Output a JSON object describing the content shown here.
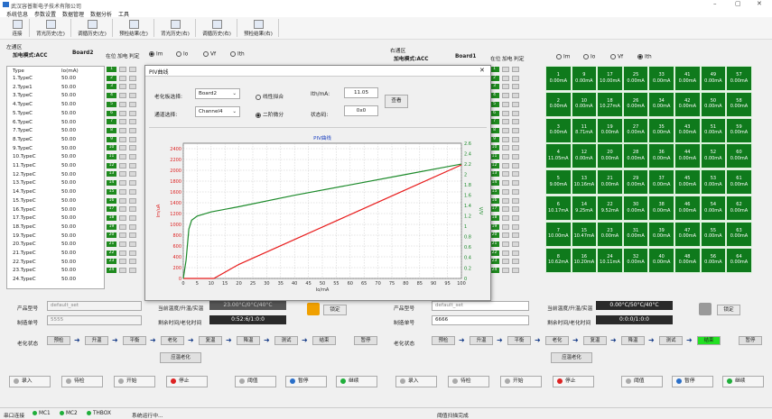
{
  "window": {
    "title": "武汉容普斯电子技术有限公司",
    "min": "–",
    "max": "▢",
    "close": "✕"
  },
  "menu": [
    "系统信息",
    "参数设置",
    "数据管理",
    "数据分析",
    "工具"
  ],
  "toolbar": [
    "连接",
    "背光历史(左)",
    "调循历史(左)",
    "预检结果(左)",
    "背光历史(右)",
    "调循历史(右)",
    "预检结果(右)"
  ],
  "left": {
    "area": "左通区",
    "mode_label": "加电模式:ACC",
    "board": "Board2",
    "cols": [
      "在位",
      "加电",
      "判定"
    ],
    "table_head": [
      "Type",
      "Io(mA)"
    ],
    "rows": [
      [
        "1.TypeC",
        "50.00"
      ],
      [
        "2.Type1",
        "50.00"
      ],
      [
        "3.TypeC",
        "50.00"
      ],
      [
        "4.TypeC",
        "50.00"
      ],
      [
        "5.TypeC",
        "50.00"
      ],
      [
        "6.TypeC",
        "50.00"
      ],
      [
        "7.TypeC",
        "50.00"
      ],
      [
        "8.TypeC",
        "50.00"
      ],
      [
        "9.TypeC",
        "50.00"
      ],
      [
        "10.TypeC",
        "50.00"
      ],
      [
        "11.TypeC",
        "50.00"
      ],
      [
        "12.TypeC",
        "50.00"
      ],
      [
        "13.TypeC",
        "50.00"
      ],
      [
        "14.TypeC",
        "50.00"
      ],
      [
        "15.TypeC",
        "50.00"
      ],
      [
        "16.TypeC",
        "50.00"
      ],
      [
        "17.TypeC",
        "50.00"
      ],
      [
        "18.TypeC",
        "50.00"
      ],
      [
        "19.TypeC",
        "50.00"
      ],
      [
        "20.TypeC",
        "50.00"
      ],
      [
        "21.TypeC",
        "50.00"
      ],
      [
        "22.TypeC",
        "50.00"
      ],
      [
        "23.TypeC",
        "50.00"
      ],
      [
        "24.TypeC",
        "50.00"
      ]
    ],
    "radios": [
      "Im",
      "Io",
      "Vf",
      "Ith"
    ],
    "product_label": "产品型号",
    "product_value": "default_set",
    "order_label": "制造单号",
    "order_value": "5555",
    "temp_label": "当前温度/升温/实温",
    "temp_value": "23.00°C/0°C/40°C",
    "time_label": "剩余时间/老化时间",
    "time_value": "0:52:6/1:0:0",
    "lock_label": "锁定",
    "state_label": "老化状态",
    "steps": [
      "预检",
      "升温",
      "平衡",
      "老化",
      "复温",
      "降温",
      "测试",
      "结束",
      "暂停"
    ],
    "back_label": "应温老化",
    "buttons": [
      "录入",
      "待检",
      "开始",
      "停止",
      "阈值",
      "暂停",
      "继续"
    ]
  },
  "right": {
    "area": "右通区",
    "mode_label": "加电模式:ACC",
    "board": "Board1",
    "cols": [
      "在位",
      "加电",
      "判定"
    ],
    "radios": [
      "Im",
      "Io",
      "Vf",
      "Ith"
    ],
    "cells": [
      [
        "1",
        "0.00mA"
      ],
      [
        "9",
        "0.00mA"
      ],
      [
        "17",
        "10.00mA"
      ],
      [
        "25",
        "0.00mA"
      ],
      [
        "33",
        "0.00mA"
      ],
      [
        "41",
        "0.00mA"
      ],
      [
        "49",
        "0.00mA"
      ],
      [
        "57",
        "0.00mA"
      ],
      [
        "2",
        "0.00mA"
      ],
      [
        "10",
        "0.00mA"
      ],
      [
        "18",
        "10.27mA"
      ],
      [
        "26",
        "0.00mA"
      ],
      [
        "34",
        "0.00mA"
      ],
      [
        "42",
        "0.00mA"
      ],
      [
        "50",
        "0.00mA"
      ],
      [
        "58",
        "0.00mA"
      ],
      [
        "3",
        "0.00mA"
      ],
      [
        "11",
        "8.71mA"
      ],
      [
        "19",
        "0.00mA"
      ],
      [
        "27",
        "0.00mA"
      ],
      [
        "35",
        "0.00mA"
      ],
      [
        "43",
        "0.00mA"
      ],
      [
        "51",
        "0.00mA"
      ],
      [
        "59",
        "0.00mA"
      ],
      [
        "4",
        "11.05mA"
      ],
      [
        "12",
        "0.00mA"
      ],
      [
        "20",
        "0.00mA"
      ],
      [
        "28",
        "0.00mA"
      ],
      [
        "36",
        "0.00mA"
      ],
      [
        "44",
        "0.00mA"
      ],
      [
        "52",
        "0.00mA"
      ],
      [
        "60",
        "0.00mA"
      ],
      [
        "5",
        "9.00mA"
      ],
      [
        "13",
        "10.16mA"
      ],
      [
        "21",
        "0.00mA"
      ],
      [
        "29",
        "0.00mA"
      ],
      [
        "37",
        "0.00mA"
      ],
      [
        "45",
        "0.00mA"
      ],
      [
        "53",
        "0.00mA"
      ],
      [
        "61",
        "0.00mA"
      ],
      [
        "6",
        "10.17mA"
      ],
      [
        "14",
        "9.25mA"
      ],
      [
        "22",
        "9.52mA"
      ],
      [
        "30",
        "0.00mA"
      ],
      [
        "38",
        "0.00mA"
      ],
      [
        "46",
        "0.00mA"
      ],
      [
        "54",
        "0.00mA"
      ],
      [
        "62",
        "0.00mA"
      ],
      [
        "7",
        "10.00mA"
      ],
      [
        "15",
        "10.47mA"
      ],
      [
        "23",
        "0.00mA"
      ],
      [
        "31",
        "0.00mA"
      ],
      [
        "39",
        "0.00mA"
      ],
      [
        "47",
        "0.00mA"
      ],
      [
        "55",
        "0.00mA"
      ],
      [
        "63",
        "0.00mA"
      ],
      [
        "8",
        "10.62mA"
      ],
      [
        "16",
        "10.20mA"
      ],
      [
        "24",
        "10.11mA"
      ],
      [
        "32",
        "0.00mA"
      ],
      [
        "40",
        "0.00mA"
      ],
      [
        "48",
        "0.00mA"
      ],
      [
        "56",
        "0.00mA"
      ],
      [
        "64",
        "0.00mA"
      ]
    ],
    "product_label": "产品型号",
    "product_value": "default_set",
    "order_label": "制造单号",
    "order_value": "6666",
    "temp_label": "当前温度/升温/实温",
    "temp_value": "0.00°C/50°C/40°C",
    "time_label": "剩余时间/老化时间",
    "time_value": "0:0:0/1:0:0",
    "lock_label": "锁定",
    "state_label": "老化状态",
    "steps": [
      "预检",
      "升温",
      "平衡",
      "老化",
      "复温",
      "降温",
      "测试",
      "结束",
      "暂停"
    ],
    "back_label": "应温老化",
    "buttons": [
      "录入",
      "待检",
      "开始",
      "停止",
      "阈值",
      "暂停",
      "继续"
    ]
  },
  "modal": {
    "title": "PIV曲线",
    "close": "✕",
    "board_label": "老化板选择:",
    "board_value": "Board2",
    "channel_label": "通道选择:",
    "channel_value": "Channel4",
    "radio1": "线性拟合",
    "radio2": "二阶微分",
    "ith_label": "Ith/mA:",
    "ith_value": "11.05",
    "state_label": "状态码:",
    "state_value": "0x0",
    "query": "查看"
  },
  "chart_data": {
    "type": "line",
    "title": "PIV曲线",
    "xlabel": "Io/mA",
    "ylabel": "Im/uA",
    "y2label": "V/V",
    "xlim": [
      0,
      100
    ],
    "ylim": [
      0,
      2500
    ],
    "y2lim": [
      0,
      2.6
    ],
    "xticks": [
      0,
      5,
      10,
      15,
      20,
      25,
      30,
      35,
      40,
      45,
      50,
      55,
      60,
      65,
      70,
      75,
      80,
      85,
      90,
      95,
      100
    ],
    "yticks": [
      0,
      200,
      400,
      600,
      800,
      1000,
      1200,
      1400,
      1600,
      1800,
      2000,
      2200,
      2400
    ],
    "y2ticks": [
      0,
      0.2,
      0.4,
      0.6,
      0.8,
      1.0,
      1.2,
      1.4,
      1.6,
      1.8,
      2.0,
      2.2,
      2.4,
      2.6
    ],
    "grid": true,
    "series": [
      {
        "axis": "left",
        "color": "#e81c1c",
        "x": [
          0,
          10,
          11,
          20,
          40,
          60,
          80,
          100
        ],
        "y": [
          0,
          0,
          0,
          260,
          720,
          1180,
          1640,
          2100
        ]
      },
      {
        "axis": "right",
        "color": "#1c8a2a",
        "x": [
          0,
          1,
          2,
          3,
          5,
          10,
          20,
          40,
          60,
          80,
          100
        ],
        "y": [
          0,
          0.35,
          0.95,
          1.12,
          1.2,
          1.28,
          1.38,
          1.6,
          1.8,
          2.0,
          2.2
        ]
      }
    ]
  },
  "status": {
    "conn": "串口连接",
    "items": [
      "MC1",
      "MC2",
      "THBOX"
    ],
    "msg": "系统运行中...",
    "right_msg": "阈值扫描完成"
  }
}
